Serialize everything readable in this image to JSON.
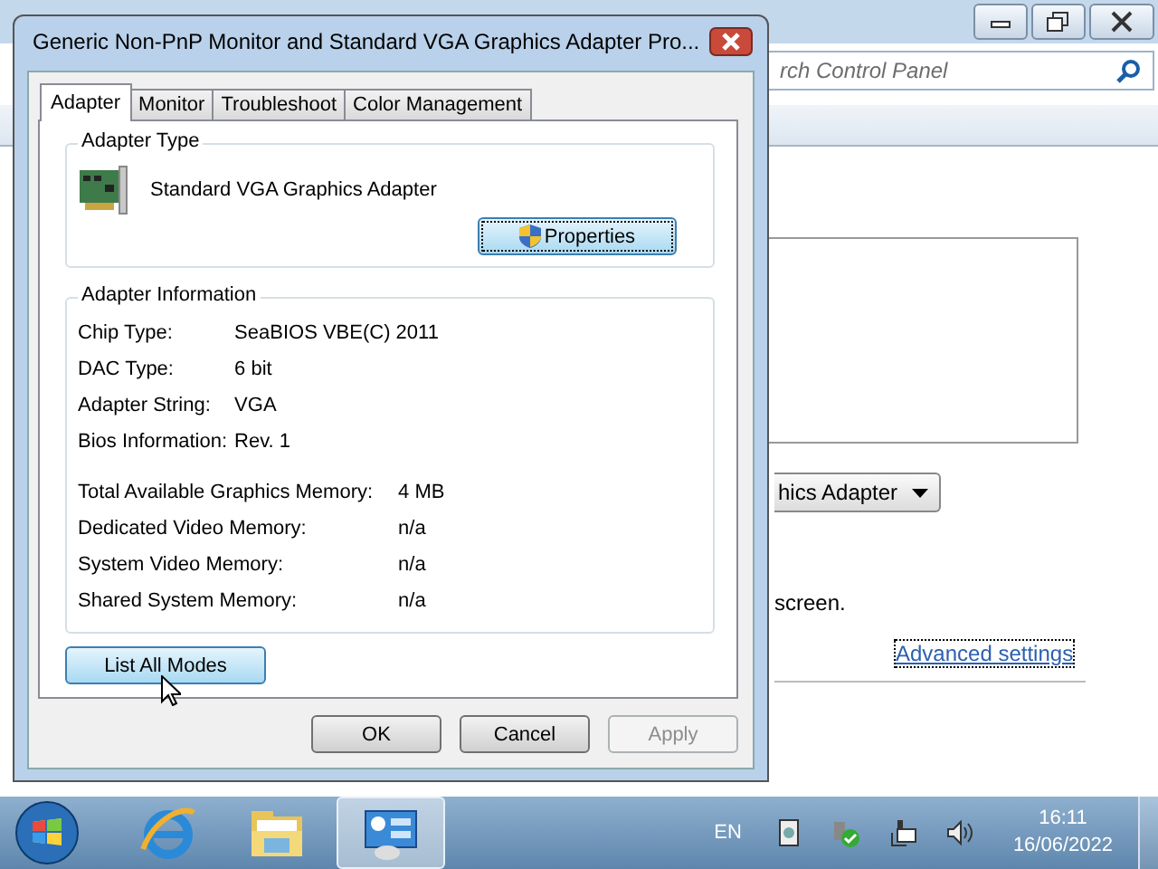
{
  "background_window": {
    "search": {
      "placeholder": "rch Control Panel"
    },
    "display_dropdown": {
      "value": "hics Adapter"
    },
    "note": "screen.",
    "link": "Advanced settings"
  },
  "dialog": {
    "title": "Generic Non-PnP Monitor and Standard VGA Graphics Adapter Pro...",
    "tabs": [
      {
        "label": "Adapter",
        "selected": true
      },
      {
        "label": "Monitor",
        "selected": false
      },
      {
        "label": "Troubleshoot",
        "selected": false
      },
      {
        "label": "Color Management",
        "selected": false
      }
    ],
    "adapter_type": {
      "heading": "Adapter Type",
      "name": "Standard VGA Graphics Adapter",
      "button": "Properties"
    },
    "adapter_information": {
      "heading": "Adapter Information",
      "details": [
        {
          "label": "Chip Type:",
          "value": "SeaBIOS VBE(C) 2011"
        },
        {
          "label": "DAC Type:",
          "value": "6 bit"
        },
        {
          "label": "Adapter String:",
          "value": "VGA"
        },
        {
          "label": "Bios Information:",
          "value": "Rev. 1"
        }
      ],
      "memory": [
        {
          "label": "Total Available Graphics Memory:",
          "value": "4 MB"
        },
        {
          "label": "Dedicated Video Memory:",
          "value": "n/a"
        },
        {
          "label": "System Video Memory:",
          "value": "n/a"
        },
        {
          "label": "Shared System Memory:",
          "value": "n/a"
        }
      ]
    },
    "list_button": "List All Modes",
    "buttons": [
      {
        "label": "OK",
        "disabled": false
      },
      {
        "label": "Cancel",
        "disabled": false
      },
      {
        "label": "Apply",
        "disabled": true
      }
    ]
  },
  "taskbar": {
    "language": "EN",
    "time": "16:11",
    "date": "16/06/2022"
  }
}
